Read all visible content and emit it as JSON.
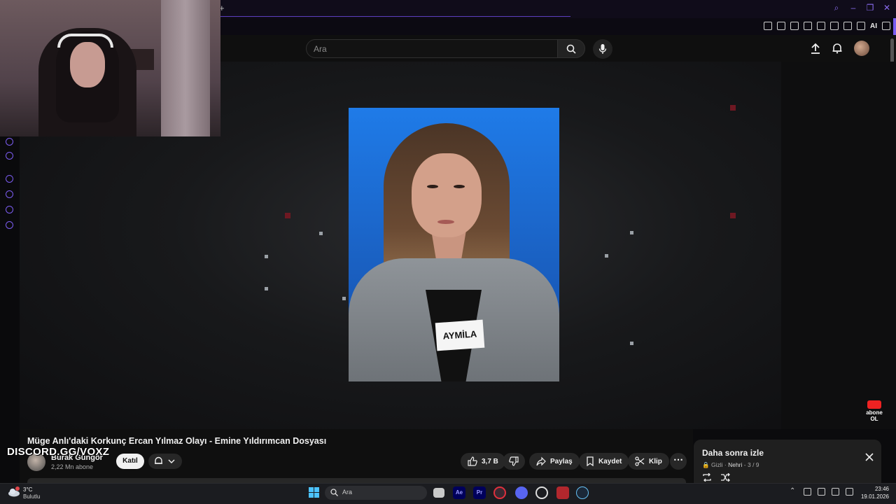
{
  "browser": {
    "new_tab": "+",
    "extensions_ai": "AI"
  },
  "youtube": {
    "search_placeholder": "Ara",
    "icons": [
      "search-icon",
      "mic-icon",
      "upload-icon",
      "bell-icon",
      "avatar"
    ]
  },
  "video": {
    "title": "Müge Anlı'daki Korkunç Ercan Yılmaz Olayı - Emine Yıldırımcan Dosyası",
    "nametag": "AYMİLA",
    "subscribe_badge": [
      "abone",
      "OL"
    ]
  },
  "overlay": {
    "discord": "DISCORD.GG/VOXZ"
  },
  "channel": {
    "name": "Burak Güngör",
    "subscribers": "2,22 Mn abone",
    "join_label": "Katıl"
  },
  "actions": {
    "likes": "3,7 B",
    "share": "Paylaş",
    "save": "Kaydet",
    "clip": "Klip",
    "more": "⋯"
  },
  "watch_later": {
    "title": "Daha sonra izle",
    "privacy": "Gizli",
    "owner": "Nehri",
    "position": "3 / 9"
  },
  "taskbar": {
    "temperature": "3°C",
    "weather": "Bulutlu",
    "search_placeholder": "Ara",
    "time": "23:46",
    "date": "19.01.2026",
    "apps": [
      "Ae",
      "Pr"
    ]
  },
  "colors": {
    "accent": "#7b5cf0",
    "youtube_red": "#e22222",
    "windows_blue": "#4cc2ff"
  }
}
